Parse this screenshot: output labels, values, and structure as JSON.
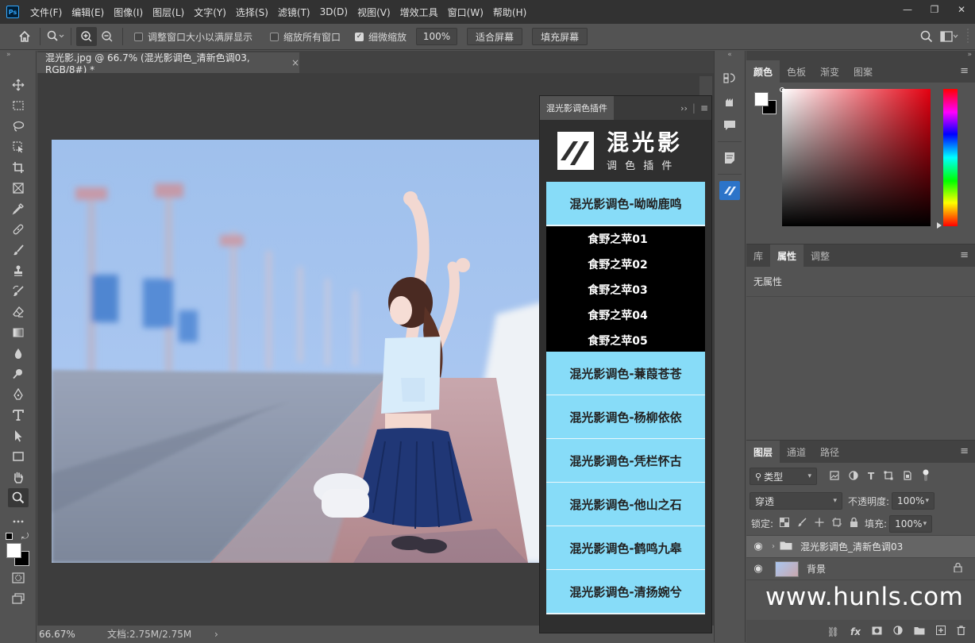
{
  "app": {
    "logo_text": "Ps"
  },
  "menu": [
    "文件(F)",
    "编辑(E)",
    "图像(I)",
    "图层(L)",
    "文字(Y)",
    "选择(S)",
    "滤镜(T)",
    "3D(D)",
    "视图(V)",
    "增效工具",
    "窗口(W)",
    "帮助(H)"
  ],
  "window_controls": {
    "minimize": "—",
    "restore": "❐",
    "close": "✕"
  },
  "options_bar": {
    "resize_windows": "调整窗口大小以满屏显示",
    "zoom_all": "缩放所有窗口",
    "scrubby_zoom": "细微缩放",
    "zoom_value": "100%",
    "fit_screen": "适合屏幕",
    "fill_screen": "填充屏幕"
  },
  "document": {
    "tab_title": "混光影.jpg @ 66.7% (混光影调色_清新色调03, RGB/8#) *",
    "close": "×"
  },
  "status": {
    "zoom": "66.67%",
    "doc_size": "文档:2.75M/2.75M",
    "arrow": "›"
  },
  "plugin": {
    "tab": "混光影调色插件",
    "logo_main": "混光影",
    "logo_sub": "调 色 插 件",
    "buttons": [
      "混光影调色-呦呦鹿鸣",
      "混光影调色-蒹葭苍苍",
      "混光影调色-杨柳依依",
      "混光影调色-凭栏怀古",
      "混光影调色-他山之石",
      "混光影调色-鹤鸣九皋",
      "混光影调色-清扬婉兮"
    ],
    "subitems": [
      "食野之苹01",
      "食野之苹02",
      "食野之苹03",
      "食野之苹04",
      "食野之苹05"
    ]
  },
  "color_panel": {
    "tabs": [
      "颜色",
      "色板",
      "渐变",
      "图案"
    ]
  },
  "properties_panel": {
    "tabs": [
      "库",
      "属性",
      "调整"
    ],
    "content": "无属性"
  },
  "layers_panel": {
    "tabs": [
      "图层",
      "通道",
      "路径"
    ],
    "filter": "类型",
    "blend_mode": "穿透",
    "opacity_label": "不透明度:",
    "opacity_value": "100%",
    "lock_label": "锁定:",
    "fill_label": "填充:",
    "fill_value": "100%",
    "layers": [
      {
        "name": "混光影调色_清新色调03"
      },
      {
        "name": "背景"
      }
    ]
  },
  "watermark": "www.hunls.com"
}
